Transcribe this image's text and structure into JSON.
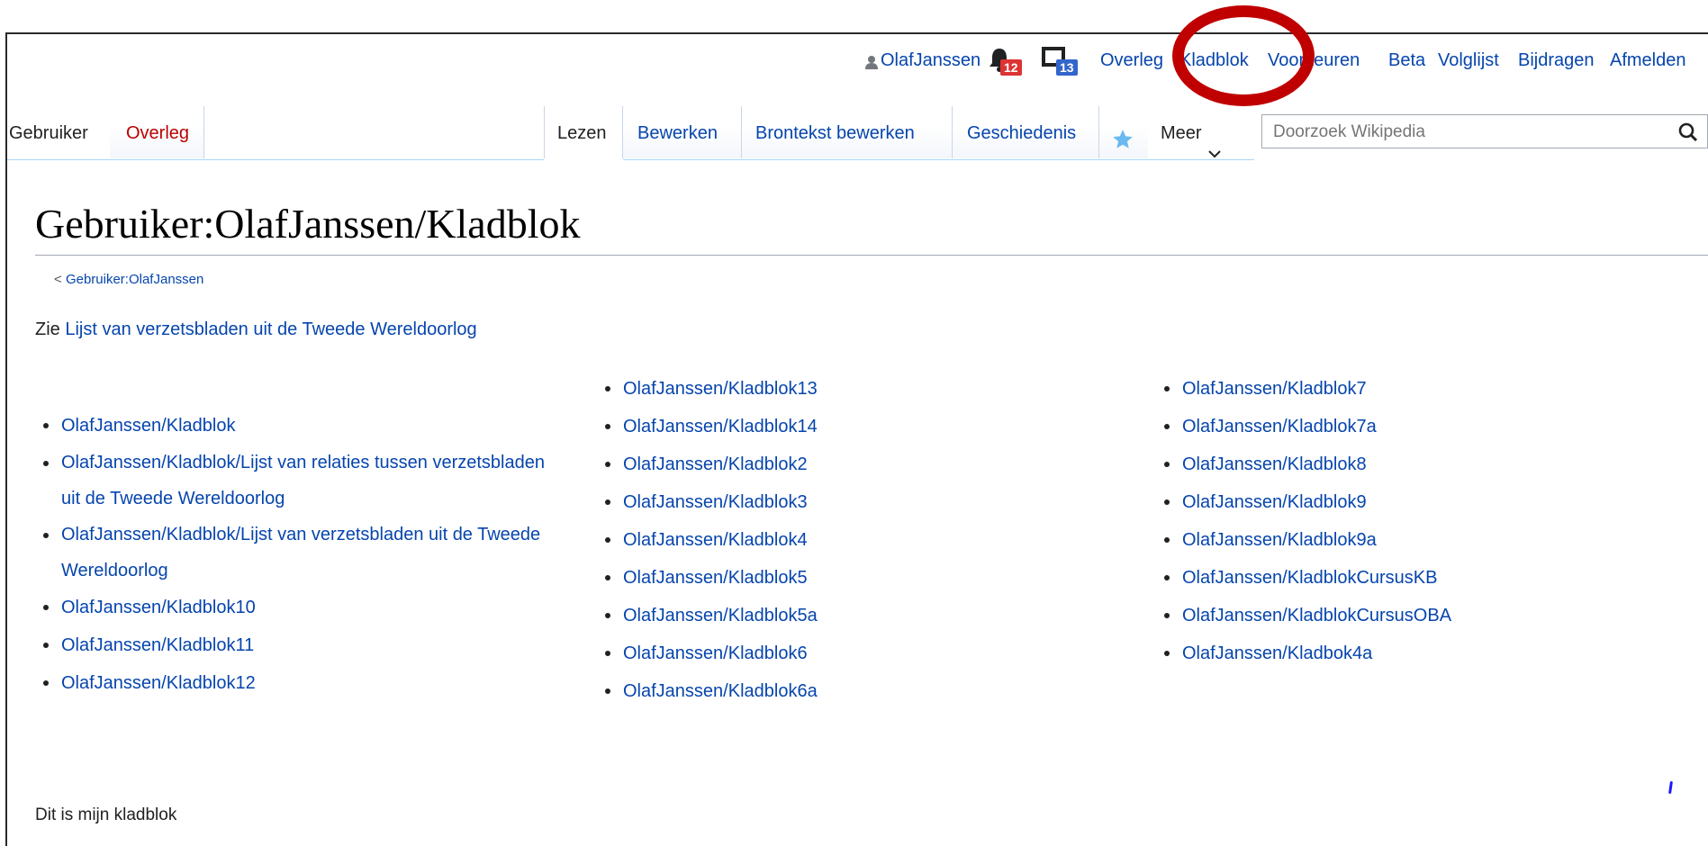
{
  "personal_tools": {
    "username": "OlafJanssen",
    "notifications_alert_count": "12",
    "notifications_notice_count": "13",
    "links": [
      "Overleg",
      "Kladblok",
      "Voorkeuren",
      "Beta",
      "Volglijst",
      "Bijdragen",
      "Afmelden"
    ]
  },
  "tabs": {
    "left": [
      "Gebruiker",
      "Overleg"
    ],
    "right": [
      "Lezen",
      "Bewerken",
      "Brontekst bewerken",
      "Geschiedenis"
    ],
    "more": "Meer"
  },
  "search": {
    "placeholder": "Doorzoek Wikipedia"
  },
  "page": {
    "title": "Gebruiker:OlafJanssen/Kladblok",
    "subpages_prefix": "<",
    "subpages_link": "Gebruiker:OlafJanssen",
    "intro_text": "Zie",
    "intro_link": "Lijst van verzetsbladen uit de Tweede Wereldoorlog",
    "outro": "Dit is mijn kladblok"
  },
  "columns": {
    "col1": [
      "OlafJanssen/Kladblok",
      "OlafJanssen/Kladblok/Lijst van relaties tussen verzetsbladen uit de Tweede Wereldoorlog",
      "OlafJanssen/Kladblok/Lijst van verzetsbladen uit de Tweede Wereldoorlog",
      "OlafJanssen/Kladblok10",
      "OlafJanssen/Kladblok11",
      "OlafJanssen/Kladblok12"
    ],
    "col2": [
      "OlafJanssen/Kladblok13",
      "OlafJanssen/Kladblok14",
      "OlafJanssen/Kladblok2",
      "OlafJanssen/Kladblok3",
      "OlafJanssen/Kladblok4",
      "OlafJanssen/Kladblok5",
      "OlafJanssen/Kladblok5a",
      "OlafJanssen/Kladblok6",
      "OlafJanssen/Kladblok6a"
    ],
    "col3": [
      "OlafJanssen/Kladblok7",
      "OlafJanssen/Kladblok7a",
      "OlafJanssen/Kladblok8",
      "OlafJanssen/Kladblok9",
      "OlafJanssen/Kladblok9a",
      "OlafJanssen/KladblokCursusKB",
      "OlafJanssen/KladblokCursusOBA",
      "OlafJanssen/Kladbok4a"
    ]
  },
  "colors": {
    "link": "#0645ad",
    "new_link": "#ba0000",
    "alert_badge": "#d33",
    "notice_badge": "#36c",
    "annotation_circle": "#c00000"
  }
}
